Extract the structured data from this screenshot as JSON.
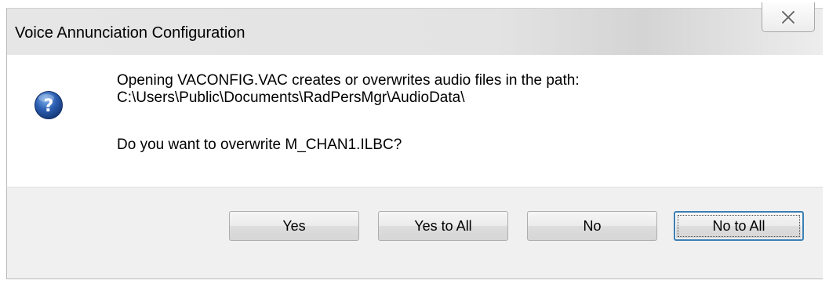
{
  "window": {
    "title": "Voice Annunciation Configuration"
  },
  "icons": {
    "close": "close-icon",
    "question": "question-icon"
  },
  "message": {
    "line1": "Opening VACONFIG.VAC creates or overwrites audio files in the path:",
    "line2": "C:\\Users\\Public\\Documents\\RadPersMgr\\AudioData\\",
    "line3": "Do you want to overwrite M_CHAN1.ILBC?"
  },
  "buttons": {
    "yes": "Yes",
    "yes_to_all": "Yes to All",
    "no": "No",
    "no_to_all": "No to All"
  },
  "colors": {
    "question_icon": "#2a5db0",
    "default_button_border": "#3c7fb1"
  }
}
